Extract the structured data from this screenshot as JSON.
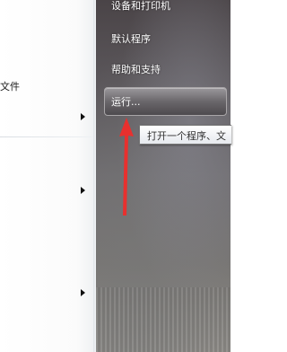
{
  "left_pane": {
    "partial_label": "文件"
  },
  "right_menu": {
    "items": [
      {
        "label": "设备和打印机"
      },
      {
        "label": "默认程序"
      },
      {
        "label": "帮助和支持"
      }
    ],
    "run": {
      "label": "运行..."
    }
  },
  "tooltip": {
    "text": "打开一个程序、文"
  },
  "annotation": {
    "arrow_color": "#e8302e"
  }
}
